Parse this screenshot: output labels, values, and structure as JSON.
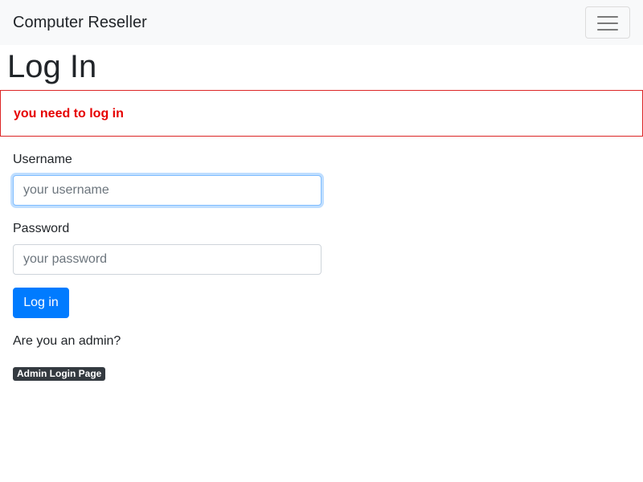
{
  "navbar": {
    "brand": "Computer Reseller",
    "toggle_icon": "hamburger-menu-icon"
  },
  "page": {
    "title": "Log In"
  },
  "alert": {
    "message": "you need to log in",
    "color": "#e60000"
  },
  "form": {
    "username_label": "Username",
    "username_placeholder": "your username",
    "username_value": "",
    "password_label": "Password",
    "password_placeholder": "your password",
    "password_value": "",
    "submit_label": "Log in"
  },
  "admin": {
    "question": "Are you an admin?",
    "link_label": "Admin Login Page"
  },
  "colors": {
    "primary": "#007bff",
    "navbar_bg": "#f8f9fa",
    "badge_bg": "#343a40",
    "alert_border": "#dc2626"
  }
}
